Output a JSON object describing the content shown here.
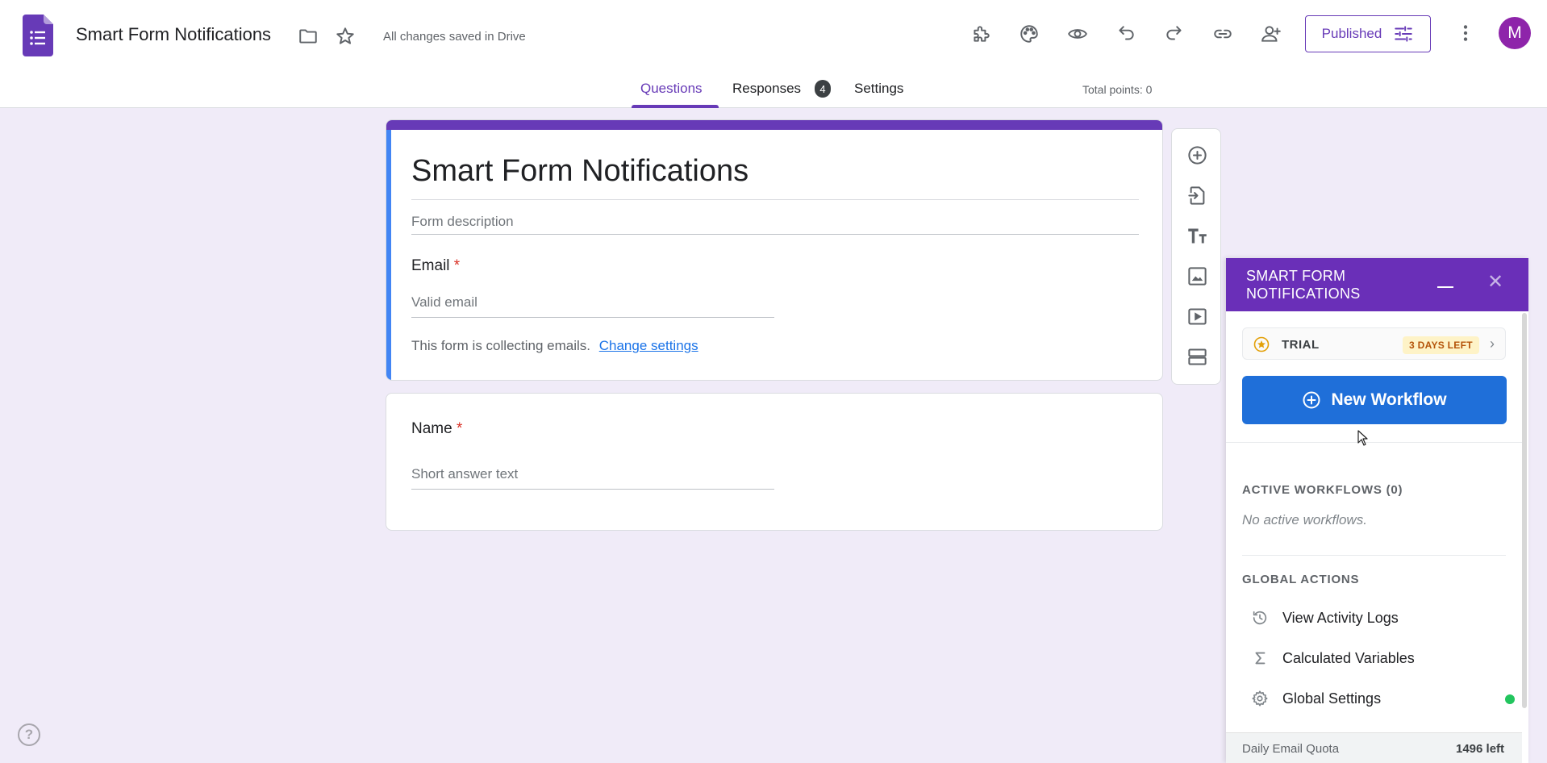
{
  "app": {
    "doc_title": "Smart Form Notifications",
    "saved_status": "All changes saved in Drive",
    "published_label": "Published",
    "avatar_initial": "M",
    "brand_color": "#673ab7"
  },
  "tabs": {
    "questions": "Questions",
    "responses": "Responses",
    "responses_count": "4",
    "settings": "Settings",
    "total_points": "Total points: 0"
  },
  "form": {
    "title": "Smart Form Notifications",
    "description_placeholder": "Form description",
    "email_question": {
      "label": "Email",
      "required_mark": "*",
      "placeholder": "Valid email"
    },
    "collecting_text": "This form is collecting emails.",
    "change_settings_link": "Change settings",
    "name_question": {
      "label": "Name",
      "required_mark": "*",
      "placeholder": "Short answer text"
    }
  },
  "toolbar": {
    "icons": [
      "add-question-icon",
      "import-questions-icon",
      "add-title-icon",
      "add-image-icon",
      "add-video-icon",
      "add-section-icon"
    ]
  },
  "panel": {
    "title": "SMART FORM NOTIFICATIONS",
    "trial_label": "TRIAL",
    "trial_badge": "3 DAYS LEFT",
    "new_workflow_label": "New Workflow",
    "active_workflows_heading": "ACTIVE WORKFLOWS (0)",
    "no_workflows_text": "No active workflows.",
    "global_actions_heading": "GLOBAL ACTIONS",
    "actions": [
      {
        "label": "View Activity Logs",
        "icon": "history-icon"
      },
      {
        "label": "Calculated Variables",
        "icon": "sigma-icon"
      },
      {
        "label": "Global Settings",
        "icon": "gear-icon"
      }
    ],
    "quota_label": "Daily Email Quota",
    "quota_value": "1496 left",
    "accent_color": "#6a2fb8",
    "button_color": "#1f6fd9"
  }
}
